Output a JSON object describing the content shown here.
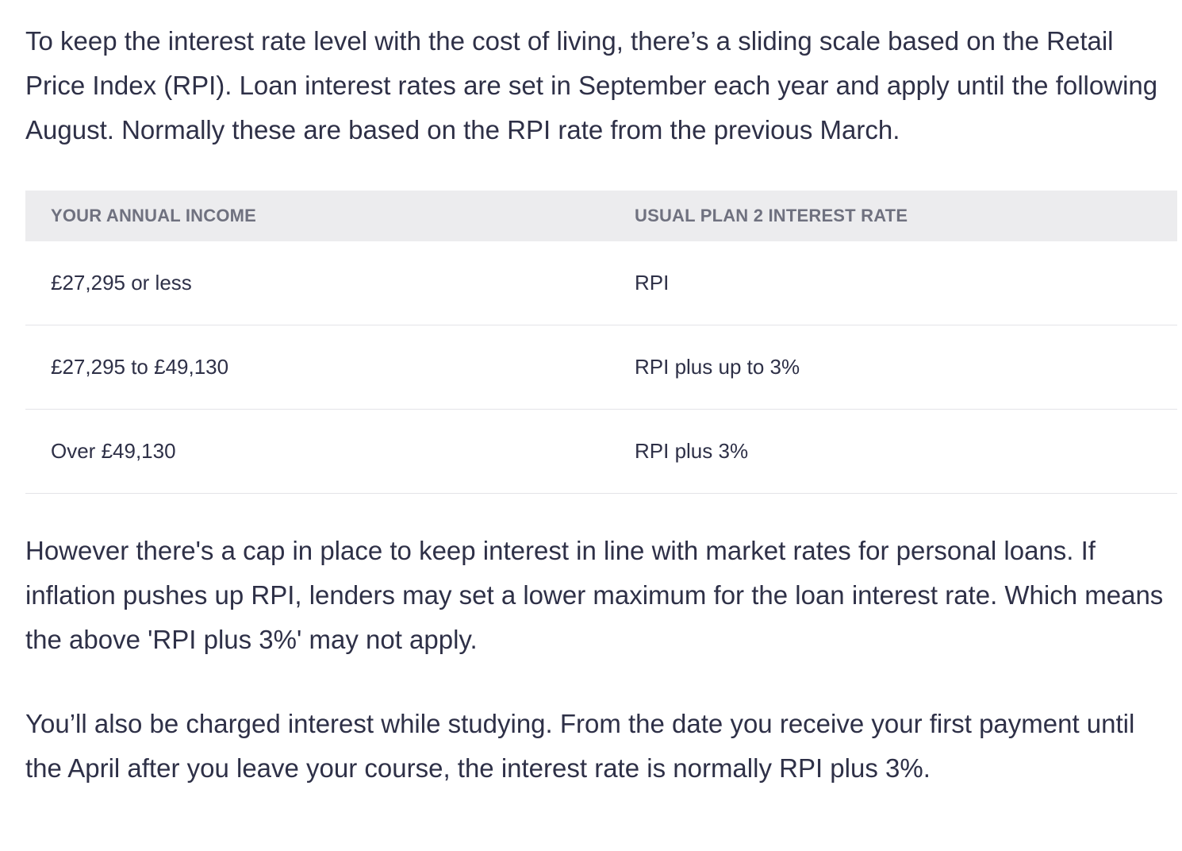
{
  "intro": "To keep the interest rate level with the cost of living, there’s a sliding scale based on the Retail Price Index (RPI). Loan interest rates are set in September each year and apply until the following August. Normally these are based on the RPI rate from the previous March.",
  "table": {
    "headers": [
      "YOUR ANNUAL INCOME",
      "USUAL PLAN 2 INTEREST RATE"
    ],
    "rows": [
      {
        "income": "£27,295 or less",
        "rate": "RPI"
      },
      {
        "income": "£27,295 to £49,130",
        "rate": "RPI plus up to 3%"
      },
      {
        "income": "Over £49,130",
        "rate": "RPI plus 3%"
      }
    ]
  },
  "cap_note": "However there's a cap in place to keep interest in line with market rates for personal loans. If inflation pushes up RPI, lenders may set a lower maximum for the loan interest rate. Which means the above 'RPI plus 3%' may not apply.",
  "study_note": "You’ll also be charged interest while studying. From the date you receive your first payment until the April after you leave your course, the interest rate is normally RPI plus 3%."
}
